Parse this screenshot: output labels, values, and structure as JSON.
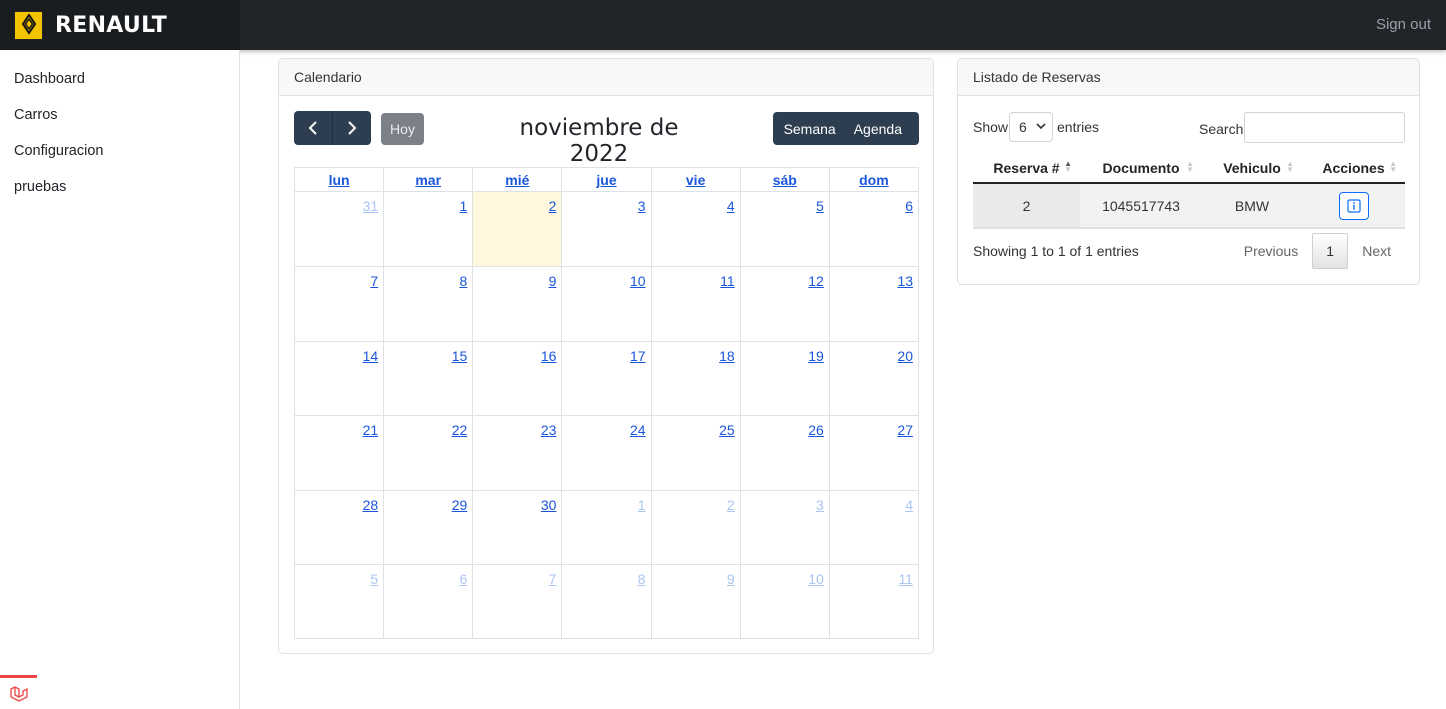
{
  "header": {
    "brand": "RENAULT",
    "signout": "Sign out"
  },
  "sidebar": {
    "items": [
      {
        "label": "Dashboard"
      },
      {
        "label": "Carros"
      },
      {
        "label": "Configuracion"
      },
      {
        "label": "pruebas"
      }
    ]
  },
  "calendar": {
    "card_title": "Calendario",
    "title": "noviembre de 2022",
    "today_label": "Hoy",
    "view_week": "Semana",
    "view_agenda": "Agenda",
    "day_headers": [
      "lun",
      "mar",
      "mié",
      "jue",
      "vie",
      "sáb",
      "dom"
    ],
    "weeks": [
      [
        {
          "d": "31",
          "o": true
        },
        {
          "d": "1"
        },
        {
          "d": "2",
          "t": true
        },
        {
          "d": "3"
        },
        {
          "d": "4"
        },
        {
          "d": "5"
        },
        {
          "d": "6"
        }
      ],
      [
        {
          "d": "7"
        },
        {
          "d": "8"
        },
        {
          "d": "9"
        },
        {
          "d": "10"
        },
        {
          "d": "11"
        },
        {
          "d": "12"
        },
        {
          "d": "13"
        }
      ],
      [
        {
          "d": "14"
        },
        {
          "d": "15"
        },
        {
          "d": "16"
        },
        {
          "d": "17"
        },
        {
          "d": "18"
        },
        {
          "d": "19"
        },
        {
          "d": "20"
        }
      ],
      [
        {
          "d": "21"
        },
        {
          "d": "22"
        },
        {
          "d": "23"
        },
        {
          "d": "24"
        },
        {
          "d": "25"
        },
        {
          "d": "26"
        },
        {
          "d": "27"
        }
      ],
      [
        {
          "d": "28"
        },
        {
          "d": "29"
        },
        {
          "d": "30"
        },
        {
          "d": "1",
          "o": true
        },
        {
          "d": "2",
          "o": true
        },
        {
          "d": "3",
          "o": true
        },
        {
          "d": "4",
          "o": true
        }
      ],
      [
        {
          "d": "5",
          "o": true
        },
        {
          "d": "6",
          "o": true
        },
        {
          "d": "7",
          "o": true
        },
        {
          "d": "8",
          "o": true
        },
        {
          "d": "9",
          "o": true
        },
        {
          "d": "10",
          "o": true
        },
        {
          "d": "11",
          "o": true
        }
      ]
    ]
  },
  "reservas": {
    "card_title": "Listado de Reservas",
    "show_label": "Show",
    "entries_value": "6",
    "entries_label": "entries",
    "search_label": "Search:",
    "search_value": "",
    "columns": [
      "Reserva #",
      "Documento",
      "Vehiculo",
      "Acciones"
    ],
    "rows": [
      {
        "reserva": "2",
        "documento": "1045517743",
        "vehiculo": "BMW",
        "action_icon": "info-icon"
      }
    ],
    "info": "Showing 1 to 1 of 1 entries",
    "prev": "Previous",
    "page": "1",
    "next": "Next"
  },
  "colors": {
    "topbar": "#212529",
    "nav_buttons": "#2c3e50",
    "link": "#1a56db",
    "today": "#fff8dc",
    "laravel": "#ef4444"
  }
}
